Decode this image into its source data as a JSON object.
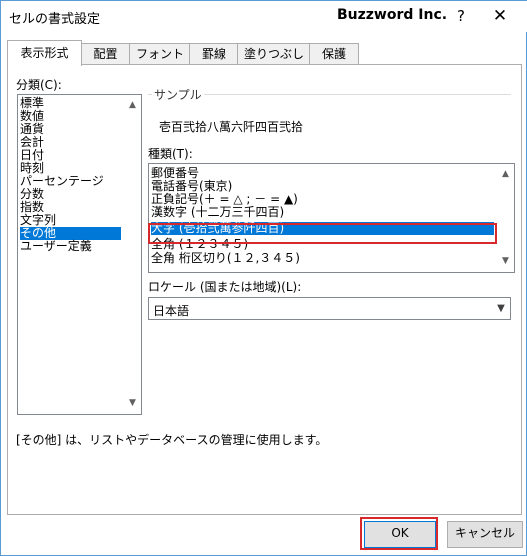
{
  "window": {
    "title": "セルの書式設定",
    "brand": "Buzzword Inc.",
    "help": "?",
    "close": "✕"
  },
  "tabs": [
    {
      "label": "表示形式",
      "active": true
    },
    {
      "label": "配置"
    },
    {
      "label": "フォント"
    },
    {
      "label": "罫線"
    },
    {
      "label": "塗りつぶし"
    },
    {
      "label": "保護"
    }
  ],
  "category": {
    "label": "分類(C):",
    "items": [
      "標準",
      "数値",
      "通貨",
      "会計",
      "日付",
      "時刻",
      "パーセンテージ",
      "分数",
      "指数",
      "文字列",
      "その他",
      "ユーザー定義"
    ],
    "selected": "その他"
  },
  "sample": {
    "label": "サンプル",
    "value": "壱百弐拾八萬六阡四百弐拾"
  },
  "type": {
    "label": "種類(T):",
    "items": [
      "郵便番号",
      "電話番号(東京)",
      "正負記号(＋ = △ ; － = ▲)",
      "漢数字 (十二万三千四百)",
      "大字 (壱拾弐萬参阡四百)",
      "全角 (１２３４５)",
      "全角 桁区切り(１２,３４５)"
    ],
    "selected": "大字 (壱拾弐萬参阡四百)"
  },
  "locale": {
    "label": "ロケール (国または地域)(L):",
    "value": "日本語"
  },
  "description": "[その他] は、リストやデータベースの管理に使用します。",
  "buttons": {
    "ok": "OK",
    "cancel": "キャンセル"
  },
  "colors": {
    "selection": "#0078d7",
    "highlight_box": "#d7282c"
  }
}
